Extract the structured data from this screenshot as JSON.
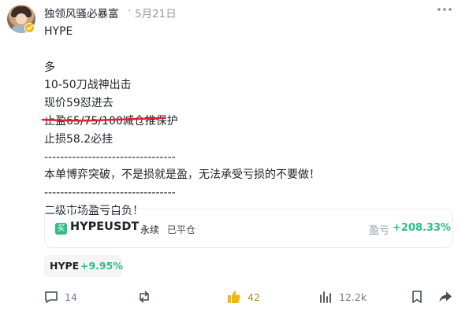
{
  "author": {
    "name": "独领风骚必暴富",
    "separator": "·",
    "date": "5月21日"
  },
  "post": {
    "lines": [
      "HYPE",
      "",
      "多",
      "10-50刀战神出击",
      "现价59怼进去",
      "止盈65/75/100减仓推保护",
      "止损58.2必挂",
      "---------------------------------",
      "本单博弈突破，不是损就是盈，无法承受亏损的不要做！",
      "---------------------------------",
      "二级市场盈亏自负！"
    ]
  },
  "trade_card": {
    "badge": "买",
    "pair": "HYPEUSDT",
    "type": "永续",
    "status": "已平仓",
    "pnl_label": "盈亏",
    "pnl_value": "+208.33%"
  },
  "ticker": {
    "symbol": "HYPE",
    "change": "+9.95%"
  },
  "actions": {
    "comments": "14",
    "likes": "42",
    "views": "12.2k"
  },
  "colors": {
    "positive": "#2ebd85",
    "muted": "#929aa5",
    "highlight_underline": "#e0212f",
    "like_icon": "#f0b90b",
    "verified_badge": "#f0b90b"
  },
  "icons": {
    "more": "more-horizontal-icon",
    "comment": "comment-icon",
    "repost": "repost-icon",
    "like": "thumbs-up-icon",
    "views": "views-bar-icon",
    "bookmark": "bookmark-icon",
    "share": "share-icon",
    "verified": "verified-badge-icon"
  }
}
